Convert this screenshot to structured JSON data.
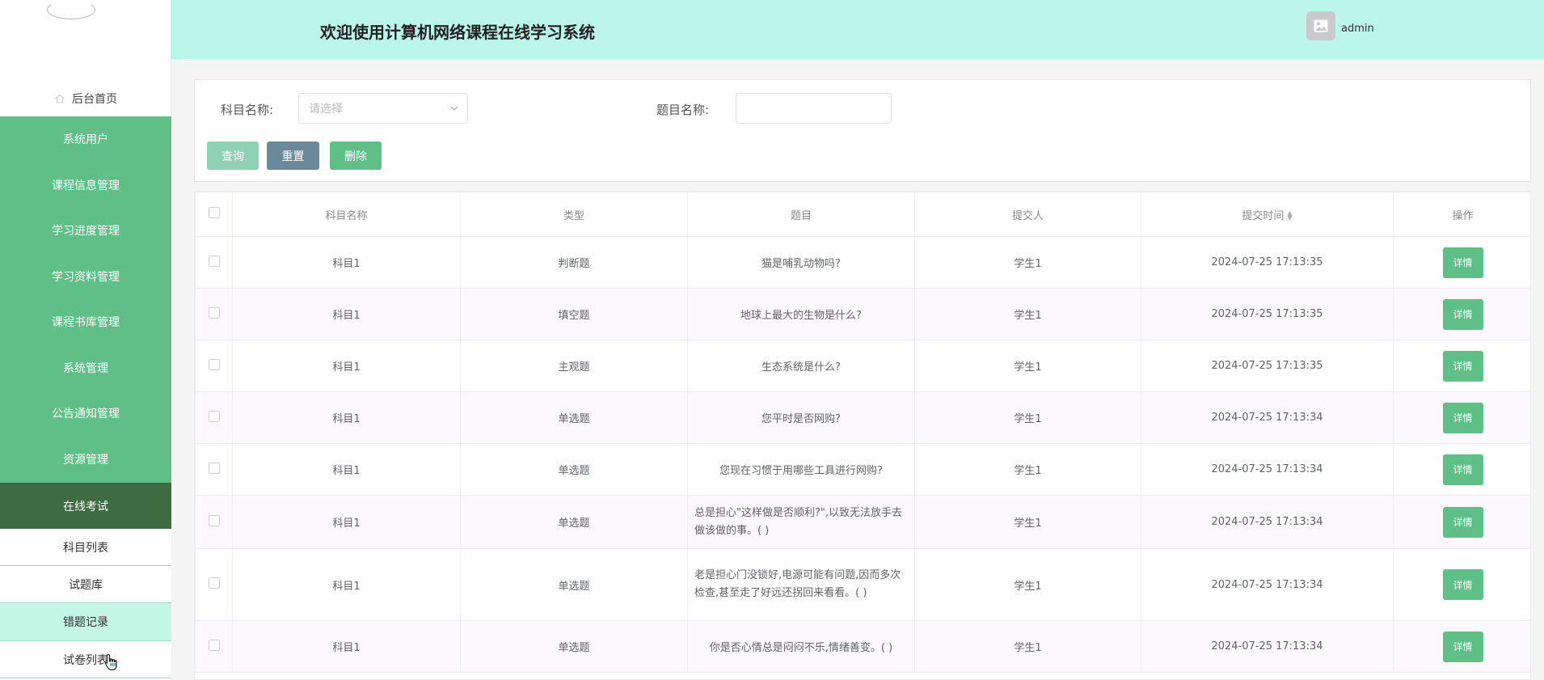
{
  "sidebar": {
    "home_label": "后台首页",
    "menu": [
      "系统用户",
      "课程信息管理",
      "学习进度管理",
      "学习资料管理",
      "课程书库管理",
      "系统管理",
      "公告通知管理",
      "资源管理"
    ],
    "active_menu": "在线考试",
    "submenu": [
      "科目列表",
      "试题库",
      "错题记录",
      "试卷列表"
    ]
  },
  "header": {
    "title": "欢迎使用计算机网络课程在线学习系统",
    "username": "admin"
  },
  "search": {
    "subject_label": "科目名称:",
    "subject_placeholder": "请选择",
    "question_label": "题目名称:",
    "query_btn": "查询",
    "reset_btn": "重置",
    "delete_btn": "删除"
  },
  "table": {
    "headers": [
      "科目名称",
      "类型",
      "题目",
      "提交人",
      "提交时间",
      "操作"
    ],
    "detail_label": "详情",
    "rows": [
      {
        "subject": "科目1",
        "type": "判断题",
        "question": "猫是哺乳动物吗?",
        "submitter": "学生1",
        "time": "2024-07-25 17:13:35"
      },
      {
        "subject": "科目1",
        "type": "填空题",
        "question": "地球上最大的生物是什么?",
        "submitter": "学生1",
        "time": "2024-07-25 17:13:35"
      },
      {
        "subject": "科目1",
        "type": "主观题",
        "question": "生态系统是什么?",
        "submitter": "学生1",
        "time": "2024-07-25 17:13:35"
      },
      {
        "subject": "科目1",
        "type": "单选题",
        "question": "您平时是否网购?",
        "submitter": "学生1",
        "time": "2024-07-25 17:13:34"
      },
      {
        "subject": "科目1",
        "type": "单选题",
        "question": "您现在习惯于用哪些工具进行网购?",
        "submitter": "学生1",
        "time": "2024-07-25 17:13:34"
      },
      {
        "subject": "科目1",
        "type": "单选题",
        "question": "总是担心\"这样做是否顺利?\",以致无法放手去做该做的事。( )",
        "submitter": "学生1",
        "time": "2024-07-25 17:13:34"
      },
      {
        "subject": "科目1",
        "type": "单选题",
        "question": "老是担心门没锁好,电源可能有问题,因而多次检查,甚至走了好远还拐回来看看。( )",
        "submitter": "学生1",
        "time": "2024-07-25 17:13:34"
      },
      {
        "subject": "科目1",
        "type": "单选题",
        "question": "你是否心情总是闷闷不乐,情绪善变。( )",
        "submitter": "学生1",
        "time": "2024-07-25 17:13:34"
      }
    ]
  },
  "colors": {
    "sidebar_green": "#5fbf86",
    "sidebar_active": "#3e6b40",
    "header_bg": "#bcf6e8",
    "submenu_active": "#c4f6e6",
    "btn_query": "#8fd1b2",
    "btn_reset": "#6b8a99",
    "btn_delete": "#5fbf86"
  }
}
